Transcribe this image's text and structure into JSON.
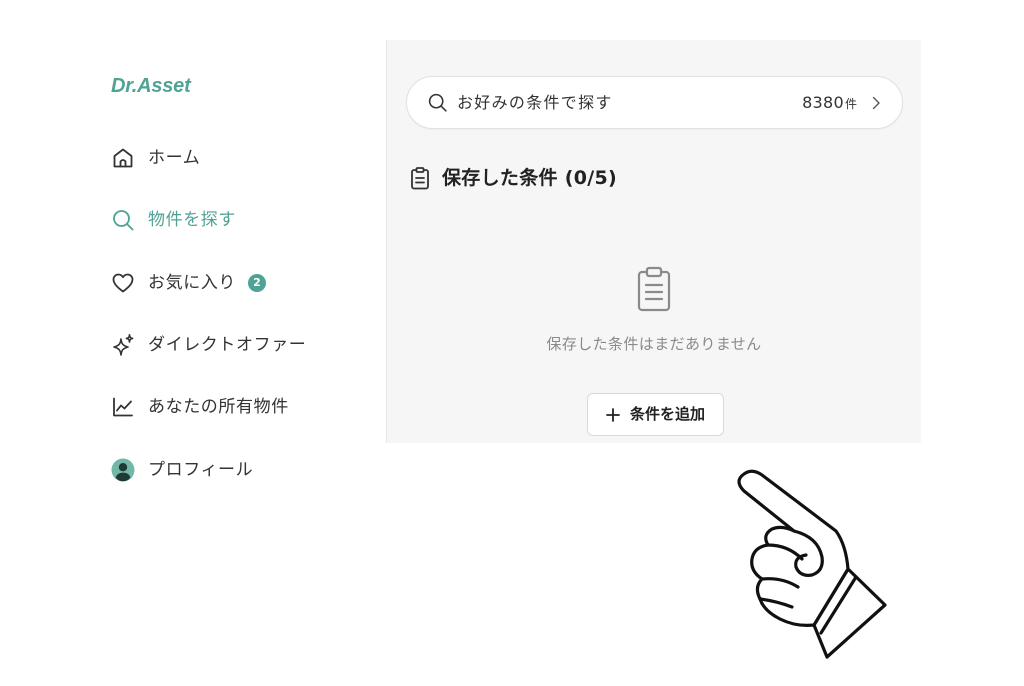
{
  "app": {
    "logo": "Dr.Asset"
  },
  "colors": {
    "brand": "#4fa394",
    "text": "#333333",
    "muted": "#8a8a8a",
    "panel_background": "#f6f6f6"
  },
  "sidebar": {
    "items": [
      {
        "label": "ホーム",
        "icon": "home-icon",
        "active": false
      },
      {
        "label": "物件を探す",
        "icon": "search-icon",
        "active": true
      },
      {
        "label": "お気に入り",
        "icon": "heart-icon",
        "active": false,
        "badge": "2"
      },
      {
        "label": "ダイレクトオファー",
        "icon": "sparkles-icon",
        "active": false
      },
      {
        "label": "あなたの所有物件",
        "icon": "line-chart-icon",
        "active": false
      },
      {
        "label": "プロフィール",
        "icon": "avatar-icon",
        "active": false
      }
    ]
  },
  "main": {
    "search": {
      "icon": "search-icon",
      "label": "お好みの条件で探す",
      "count": "8380",
      "count_unit": "件",
      "chevron_icon": "chevron-right-icon"
    },
    "saved_conditions": {
      "title_icon": "clipboard-icon",
      "title": "保存した条件 (0/5)",
      "empty_icon": "clipboard-icon",
      "empty_message": "保存した条件はまだありません",
      "add_button_icon": "plus-icon",
      "add_button_label": "条件を追加"
    }
  },
  "decoration": {
    "illustration": "pointing-hand-icon"
  }
}
